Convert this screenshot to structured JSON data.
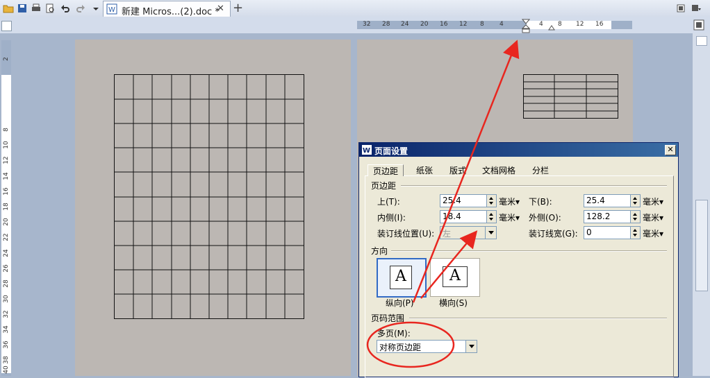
{
  "window": {
    "tab_title": "新建 Micros...(2).doc *",
    "close_tab": "✕",
    "new_tab": "+"
  },
  "hruler": {
    "left_ticks": [
      "32",
      "28",
      "24",
      "20",
      "16",
      "12",
      "8",
      "4"
    ],
    "right_ticks": [
      "4",
      "8",
      "12",
      "16"
    ]
  },
  "vruler": {
    "ticks": [
      "2",
      "8",
      "10",
      "12",
      "14",
      "16",
      "18",
      "20",
      "22",
      "24",
      "26",
      "28",
      "30",
      "32",
      "34",
      "36",
      "38",
      "40"
    ]
  },
  "dialog": {
    "title": "页面设置",
    "close": "✕",
    "tabs": [
      "页边距",
      "纸张",
      "版式",
      "文档网格",
      "分栏"
    ],
    "margin_group": "页边距",
    "top_label": "上(T):",
    "top_value": "25.4",
    "bottom_label": "下(B):",
    "bottom_value": "25.4",
    "inside_label": "内侧(I):",
    "inside_value": "18.4",
    "outside_label": "外侧(O):",
    "outside_value": "128.2",
    "gutter_pos_label": "装订线位置(U):",
    "gutter_pos_value": "左",
    "gutter_width_label": "装订线宽(G):",
    "gutter_width_value": "0",
    "unit": "毫米▾",
    "orientation_group": "方向",
    "portrait_label": "纵向(P)",
    "landscape_label": "横向(S)",
    "orientation_glyph": "A",
    "pages_group": "页码范围",
    "multi_pages_label": "多页(M):",
    "multi_pages_value": "对称页边距"
  },
  "colors": {
    "annotation": "#e8261f",
    "dialog_title_bg": "#0a246a"
  }
}
